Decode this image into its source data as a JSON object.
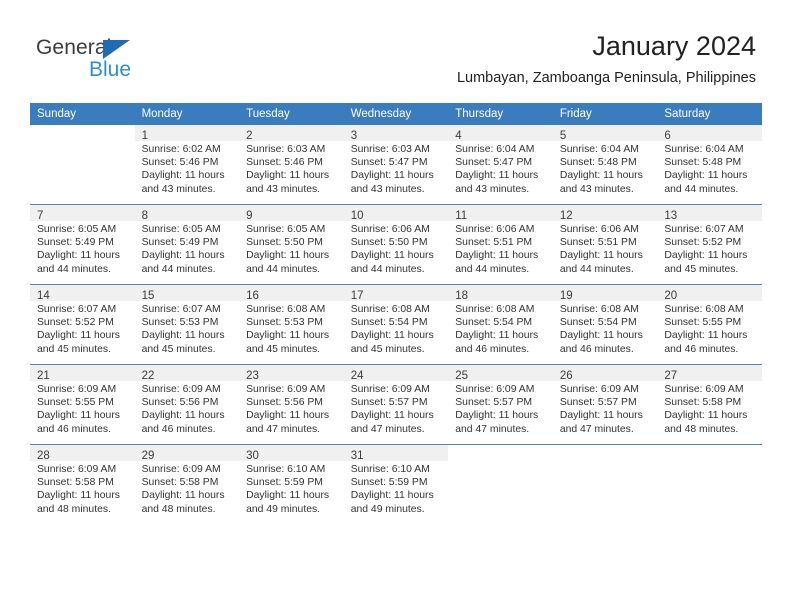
{
  "brand": {
    "name_part1": "General",
    "name_part2": "Blue",
    "triangle_color": "#1f6cb4",
    "blue_text_color": "#2b8fd6"
  },
  "header": {
    "title": "January 2024",
    "subtitle": "Lumbayan, Zamboanga Peninsula, Philippines"
  },
  "theme": {
    "header_row_bg": "#3a7cbe",
    "header_row_text": "#ffffff",
    "daynum_band_bg": "#f0f0f0",
    "row_divider": "#4a86c2"
  },
  "calendar": {
    "weekday_headers": [
      "Sunday",
      "Monday",
      "Tuesday",
      "Wednesday",
      "Thursday",
      "Friday",
      "Saturday"
    ],
    "weeks": [
      [
        {
          "day": "",
          "sunrise": "",
          "sunset": "",
          "daylight_line1": "",
          "daylight_line2": ""
        },
        {
          "day": "1",
          "sunrise": "Sunrise: 6:02 AM",
          "sunset": "Sunset: 5:46 PM",
          "daylight_line1": "Daylight: 11 hours",
          "daylight_line2": "and 43 minutes."
        },
        {
          "day": "2",
          "sunrise": "Sunrise: 6:03 AM",
          "sunset": "Sunset: 5:46 PM",
          "daylight_line1": "Daylight: 11 hours",
          "daylight_line2": "and 43 minutes."
        },
        {
          "day": "3",
          "sunrise": "Sunrise: 6:03 AM",
          "sunset": "Sunset: 5:47 PM",
          "daylight_line1": "Daylight: 11 hours",
          "daylight_line2": "and 43 minutes."
        },
        {
          "day": "4",
          "sunrise": "Sunrise: 6:04 AM",
          "sunset": "Sunset: 5:47 PM",
          "daylight_line1": "Daylight: 11 hours",
          "daylight_line2": "and 43 minutes."
        },
        {
          "day": "5",
          "sunrise": "Sunrise: 6:04 AM",
          "sunset": "Sunset: 5:48 PM",
          "daylight_line1": "Daylight: 11 hours",
          "daylight_line2": "and 43 minutes."
        },
        {
          "day": "6",
          "sunrise": "Sunrise: 6:04 AM",
          "sunset": "Sunset: 5:48 PM",
          "daylight_line1": "Daylight: 11 hours",
          "daylight_line2": "and 44 minutes."
        }
      ],
      [
        {
          "day": "7",
          "sunrise": "Sunrise: 6:05 AM",
          "sunset": "Sunset: 5:49 PM",
          "daylight_line1": "Daylight: 11 hours",
          "daylight_line2": "and 44 minutes."
        },
        {
          "day": "8",
          "sunrise": "Sunrise: 6:05 AM",
          "sunset": "Sunset: 5:49 PM",
          "daylight_line1": "Daylight: 11 hours",
          "daylight_line2": "and 44 minutes."
        },
        {
          "day": "9",
          "sunrise": "Sunrise: 6:05 AM",
          "sunset": "Sunset: 5:50 PM",
          "daylight_line1": "Daylight: 11 hours",
          "daylight_line2": "and 44 minutes."
        },
        {
          "day": "10",
          "sunrise": "Sunrise: 6:06 AM",
          "sunset": "Sunset: 5:50 PM",
          "daylight_line1": "Daylight: 11 hours",
          "daylight_line2": "and 44 minutes."
        },
        {
          "day": "11",
          "sunrise": "Sunrise: 6:06 AM",
          "sunset": "Sunset: 5:51 PM",
          "daylight_line1": "Daylight: 11 hours",
          "daylight_line2": "and 44 minutes."
        },
        {
          "day": "12",
          "sunrise": "Sunrise: 6:06 AM",
          "sunset": "Sunset: 5:51 PM",
          "daylight_line1": "Daylight: 11 hours",
          "daylight_line2": "and 44 minutes."
        },
        {
          "day": "13",
          "sunrise": "Sunrise: 6:07 AM",
          "sunset": "Sunset: 5:52 PM",
          "daylight_line1": "Daylight: 11 hours",
          "daylight_line2": "and 45 minutes."
        }
      ],
      [
        {
          "day": "14",
          "sunrise": "Sunrise: 6:07 AM",
          "sunset": "Sunset: 5:52 PM",
          "daylight_line1": "Daylight: 11 hours",
          "daylight_line2": "and 45 minutes."
        },
        {
          "day": "15",
          "sunrise": "Sunrise: 6:07 AM",
          "sunset": "Sunset: 5:53 PM",
          "daylight_line1": "Daylight: 11 hours",
          "daylight_line2": "and 45 minutes."
        },
        {
          "day": "16",
          "sunrise": "Sunrise: 6:08 AM",
          "sunset": "Sunset: 5:53 PM",
          "daylight_line1": "Daylight: 11 hours",
          "daylight_line2": "and 45 minutes."
        },
        {
          "day": "17",
          "sunrise": "Sunrise: 6:08 AM",
          "sunset": "Sunset: 5:54 PM",
          "daylight_line1": "Daylight: 11 hours",
          "daylight_line2": "and 45 minutes."
        },
        {
          "day": "18",
          "sunrise": "Sunrise: 6:08 AM",
          "sunset": "Sunset: 5:54 PM",
          "daylight_line1": "Daylight: 11 hours",
          "daylight_line2": "and 46 minutes."
        },
        {
          "day": "19",
          "sunrise": "Sunrise: 6:08 AM",
          "sunset": "Sunset: 5:54 PM",
          "daylight_line1": "Daylight: 11 hours",
          "daylight_line2": "and 46 minutes."
        },
        {
          "day": "20",
          "sunrise": "Sunrise: 6:08 AM",
          "sunset": "Sunset: 5:55 PM",
          "daylight_line1": "Daylight: 11 hours",
          "daylight_line2": "and 46 minutes."
        }
      ],
      [
        {
          "day": "21",
          "sunrise": "Sunrise: 6:09 AM",
          "sunset": "Sunset: 5:55 PM",
          "daylight_line1": "Daylight: 11 hours",
          "daylight_line2": "and 46 minutes."
        },
        {
          "day": "22",
          "sunrise": "Sunrise: 6:09 AM",
          "sunset": "Sunset: 5:56 PM",
          "daylight_line1": "Daylight: 11 hours",
          "daylight_line2": "and 46 minutes."
        },
        {
          "day": "23",
          "sunrise": "Sunrise: 6:09 AM",
          "sunset": "Sunset: 5:56 PM",
          "daylight_line1": "Daylight: 11 hours",
          "daylight_line2": "and 47 minutes."
        },
        {
          "day": "24",
          "sunrise": "Sunrise: 6:09 AM",
          "sunset": "Sunset: 5:57 PM",
          "daylight_line1": "Daylight: 11 hours",
          "daylight_line2": "and 47 minutes."
        },
        {
          "day": "25",
          "sunrise": "Sunrise: 6:09 AM",
          "sunset": "Sunset: 5:57 PM",
          "daylight_line1": "Daylight: 11 hours",
          "daylight_line2": "and 47 minutes."
        },
        {
          "day": "26",
          "sunrise": "Sunrise: 6:09 AM",
          "sunset": "Sunset: 5:57 PM",
          "daylight_line1": "Daylight: 11 hours",
          "daylight_line2": "and 47 minutes."
        },
        {
          "day": "27",
          "sunrise": "Sunrise: 6:09 AM",
          "sunset": "Sunset: 5:58 PM",
          "daylight_line1": "Daylight: 11 hours",
          "daylight_line2": "and 48 minutes."
        }
      ],
      [
        {
          "day": "28",
          "sunrise": "Sunrise: 6:09 AM",
          "sunset": "Sunset: 5:58 PM",
          "daylight_line1": "Daylight: 11 hours",
          "daylight_line2": "and 48 minutes."
        },
        {
          "day": "29",
          "sunrise": "Sunrise: 6:09 AM",
          "sunset": "Sunset: 5:58 PM",
          "daylight_line1": "Daylight: 11 hours",
          "daylight_line2": "and 48 minutes."
        },
        {
          "day": "30",
          "sunrise": "Sunrise: 6:10 AM",
          "sunset": "Sunset: 5:59 PM",
          "daylight_line1": "Daylight: 11 hours",
          "daylight_line2": "and 49 minutes."
        },
        {
          "day": "31",
          "sunrise": "Sunrise: 6:10 AM",
          "sunset": "Sunset: 5:59 PM",
          "daylight_line1": "Daylight: 11 hours",
          "daylight_line2": "and 49 minutes."
        },
        {
          "day": "",
          "sunrise": "",
          "sunset": "",
          "daylight_line1": "",
          "daylight_line2": ""
        },
        {
          "day": "",
          "sunrise": "",
          "sunset": "",
          "daylight_line1": "",
          "daylight_line2": ""
        },
        {
          "day": "",
          "sunrise": "",
          "sunset": "",
          "daylight_line1": "",
          "daylight_line2": ""
        }
      ]
    ]
  }
}
